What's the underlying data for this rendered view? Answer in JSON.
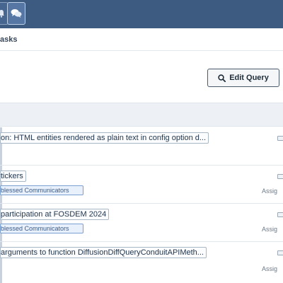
{
  "crumb": "asks",
  "edit_query": {
    "label": "Edit Query"
  },
  "tasks": [
    {
      "title": "on: HTML entities rendered as plain text in config option d...",
      "tag": "",
      "assigned": ""
    },
    {
      "title": "tickers",
      "tag": "blessed Communicators",
      "assigned": "Assig"
    },
    {
      "title": "participation at FOSDEM 2024",
      "tag": "blessed Communicators",
      "assigned": "Assig"
    },
    {
      "title": "arguments to function DiffusionDiffQueryConduitAPIMeth...",
      "tag": "",
      "assigned": "Assig"
    }
  ]
}
